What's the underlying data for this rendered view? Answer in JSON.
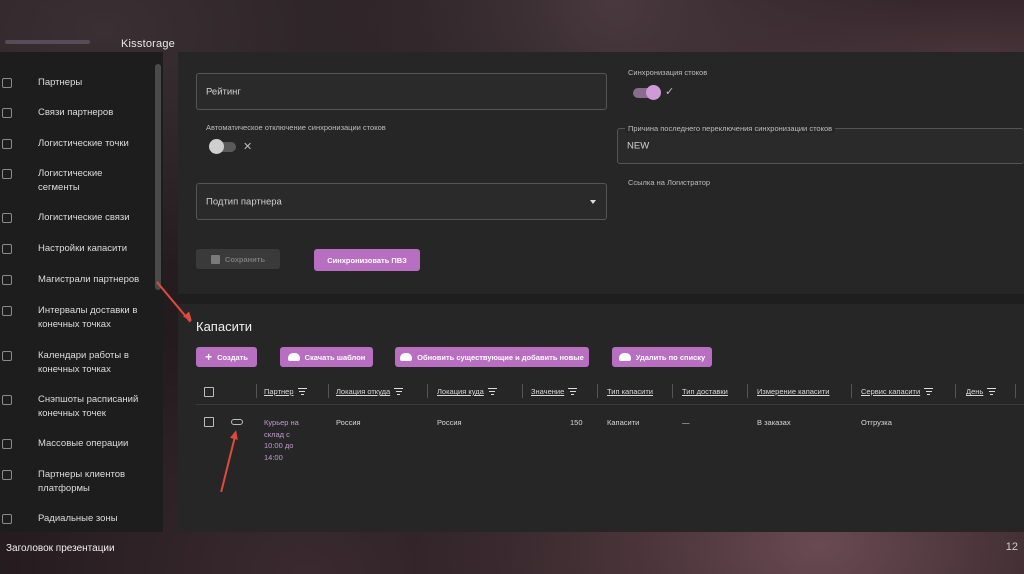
{
  "app_title": "Kisstorage",
  "sidebar": {
    "items": [
      {
        "label": "Партнеры"
      },
      {
        "label": "Связи партнеров"
      },
      {
        "label": "Логистические точки"
      },
      {
        "label": "Логистические сегменты"
      },
      {
        "label": "Логистические связи"
      },
      {
        "label": "Настройки капасити"
      },
      {
        "label": "Магистрали партнеров"
      },
      {
        "label": "Интервалы доставки в конечных точках"
      },
      {
        "label": "Календари работы в конечных точках"
      },
      {
        "label": "Снэпшоты расписаний конечных точек"
      },
      {
        "label": "Массовые операции"
      },
      {
        "label": "Партнеры клиентов платформы"
      },
      {
        "label": "Радиальные зоны"
      }
    ]
  },
  "form": {
    "rating_placeholder": "Рейтинг",
    "stock_sync_label": "Синхронизация стоков",
    "stock_sync_on": true,
    "auto_disable_label": "Автоматическое отключение синхронизации стоков",
    "auto_disable_on": false,
    "last_switch_reason_label": "Причина последнего переключения синхронизации стоков",
    "last_switch_reason_value": "NEW",
    "partner_subtype_placeholder": "Подтип партнера",
    "logistrator_link_label": "Ссылка на Логистратор",
    "save_label": "Сохранить",
    "sync_pvz_label": "Синхронизовать ПВЗ"
  },
  "capacity": {
    "title": "Капасити",
    "actions": {
      "create": "Создать",
      "download_template": "Скачать шаблон",
      "update_add": "Обновить существующие и добавить новые",
      "delete_by_list": "Удалить по списку"
    },
    "columns": [
      "Партнер",
      "Локация откуда",
      "Локация куда",
      "Значение",
      "Тип капасити",
      "Тип доставки",
      "Измерение капасити",
      "Сервис капасити",
      "День"
    ],
    "rows": [
      {
        "partner_lines": [
          "Курьер на",
          "склад с",
          "10:00 до",
          "14:00"
        ],
        "location_from": "Россия",
        "location_to": "Россия",
        "value": "150",
        "capacity_type": "Капасити",
        "delivery_type": "—",
        "capacity_measure": "В заказах",
        "capacity_service": "Отгрузка"
      }
    ]
  },
  "footer": {
    "presentation_title": "Заголовок презентации",
    "page_number": "12"
  },
  "colors": {
    "accent": "#b86fc2",
    "link": "#c49ad0",
    "annotation_arrow": "#e04a3a",
    "panel": "#262626"
  }
}
